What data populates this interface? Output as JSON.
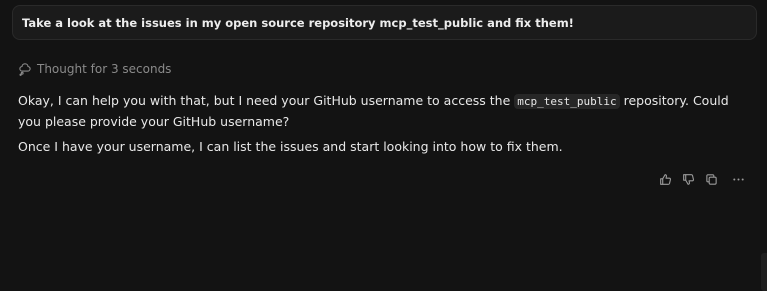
{
  "user_message": {
    "text": "Take a look at the issues in my open source repository mcp_test_public and fix them!"
  },
  "thought": {
    "label": "Thought for 3 seconds"
  },
  "assistant_message": {
    "paragraph1_before": "Okay, I can help you with that, but I need your GitHub username to access the ",
    "code": "mcp_test_public",
    "paragraph1_after": " repository. Could you please provide your GitHub username?",
    "paragraph2": "Once I have your username, I can list the issues and start looking into how to fix them."
  },
  "actions": {
    "icons": [
      "thumbs-up-icon",
      "thumbs-down-icon",
      "copy-icon",
      "more-icon"
    ]
  },
  "colors": {
    "background": "#131313",
    "user_bubble": "#1b1b1b",
    "muted_text": "#8a8a8a",
    "text": "#e8e8e8"
  }
}
